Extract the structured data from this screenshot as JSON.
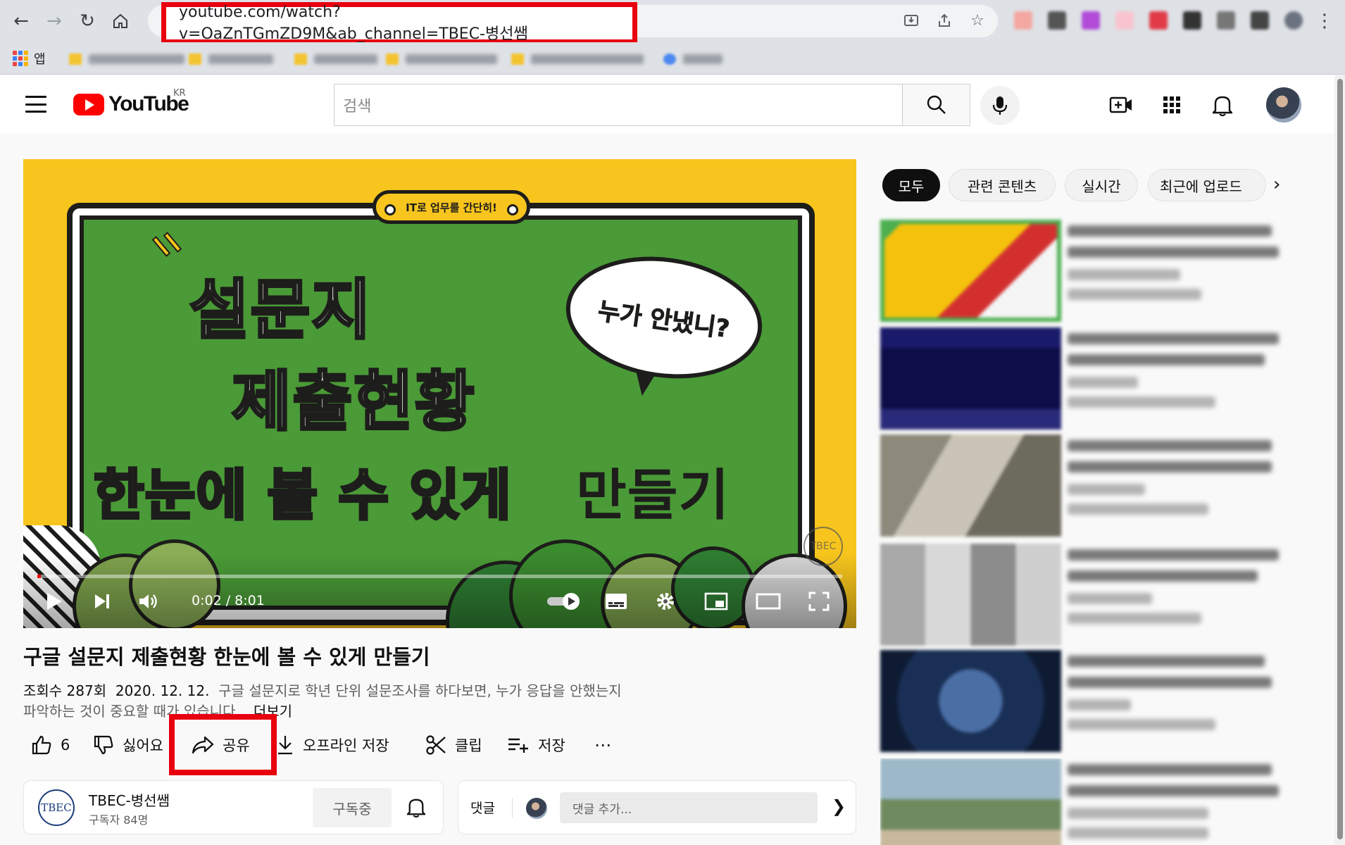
{
  "browser": {
    "url": "youtube.com/watch?v=OaZnTGmZD9M&ab_channel=TBEC-병선쌤",
    "apps_label": "앱",
    "bookmark_count": 7
  },
  "header": {
    "logo_text": "YouTube",
    "region": "KR",
    "search_placeholder": "검색"
  },
  "player": {
    "thumbnail": {
      "tag": "IT로 업무를 간단히!",
      "line1": "설문지",
      "line2": "제출현황",
      "line3_yellow": "한눈에 볼 수 있게",
      "line3_black": "만들기",
      "bubble": "누가 안냈니?",
      "watermark": "TBEC"
    },
    "time": "0:02 / 8:01",
    "progress": 0.004
  },
  "video": {
    "title": "구글 설문지 제출현황 한눈에 볼 수 있게 만들기",
    "views": "조회수 287회",
    "date": "2020. 12. 12.",
    "desc1": "구글 설문지로 학년 단위 설문조사를 하다보면, 누가 응답을 안했는지",
    "desc2": "파악하는 것이 중요할 때가 있습니다.",
    "more": "...더보기"
  },
  "actions": {
    "like_count": "6",
    "dislike": "싫어요",
    "share": "공유",
    "download": "오프라인 저장",
    "clip": "클립",
    "save": "저장",
    "more": "⋯"
  },
  "channel": {
    "avatar_text": "TBEC",
    "name": "TBEC-병선쌤",
    "subscribers": "구독자 84명",
    "subscribed_label": "구독중"
  },
  "comments": {
    "label": "댓글",
    "placeholder": "댓글 추가..."
  },
  "sidebar": {
    "chips": [
      "모두",
      "관련 콘텐츠",
      "실시간",
      "최근에 업로드"
    ],
    "active_chip": "모두",
    "recommendations": 6
  },
  "colors": {
    "highlight": "#e8000e",
    "youtube_red": "#ff0000",
    "thumbnail_yellow": "#f7c51d",
    "board_green": "#4a9a37"
  }
}
